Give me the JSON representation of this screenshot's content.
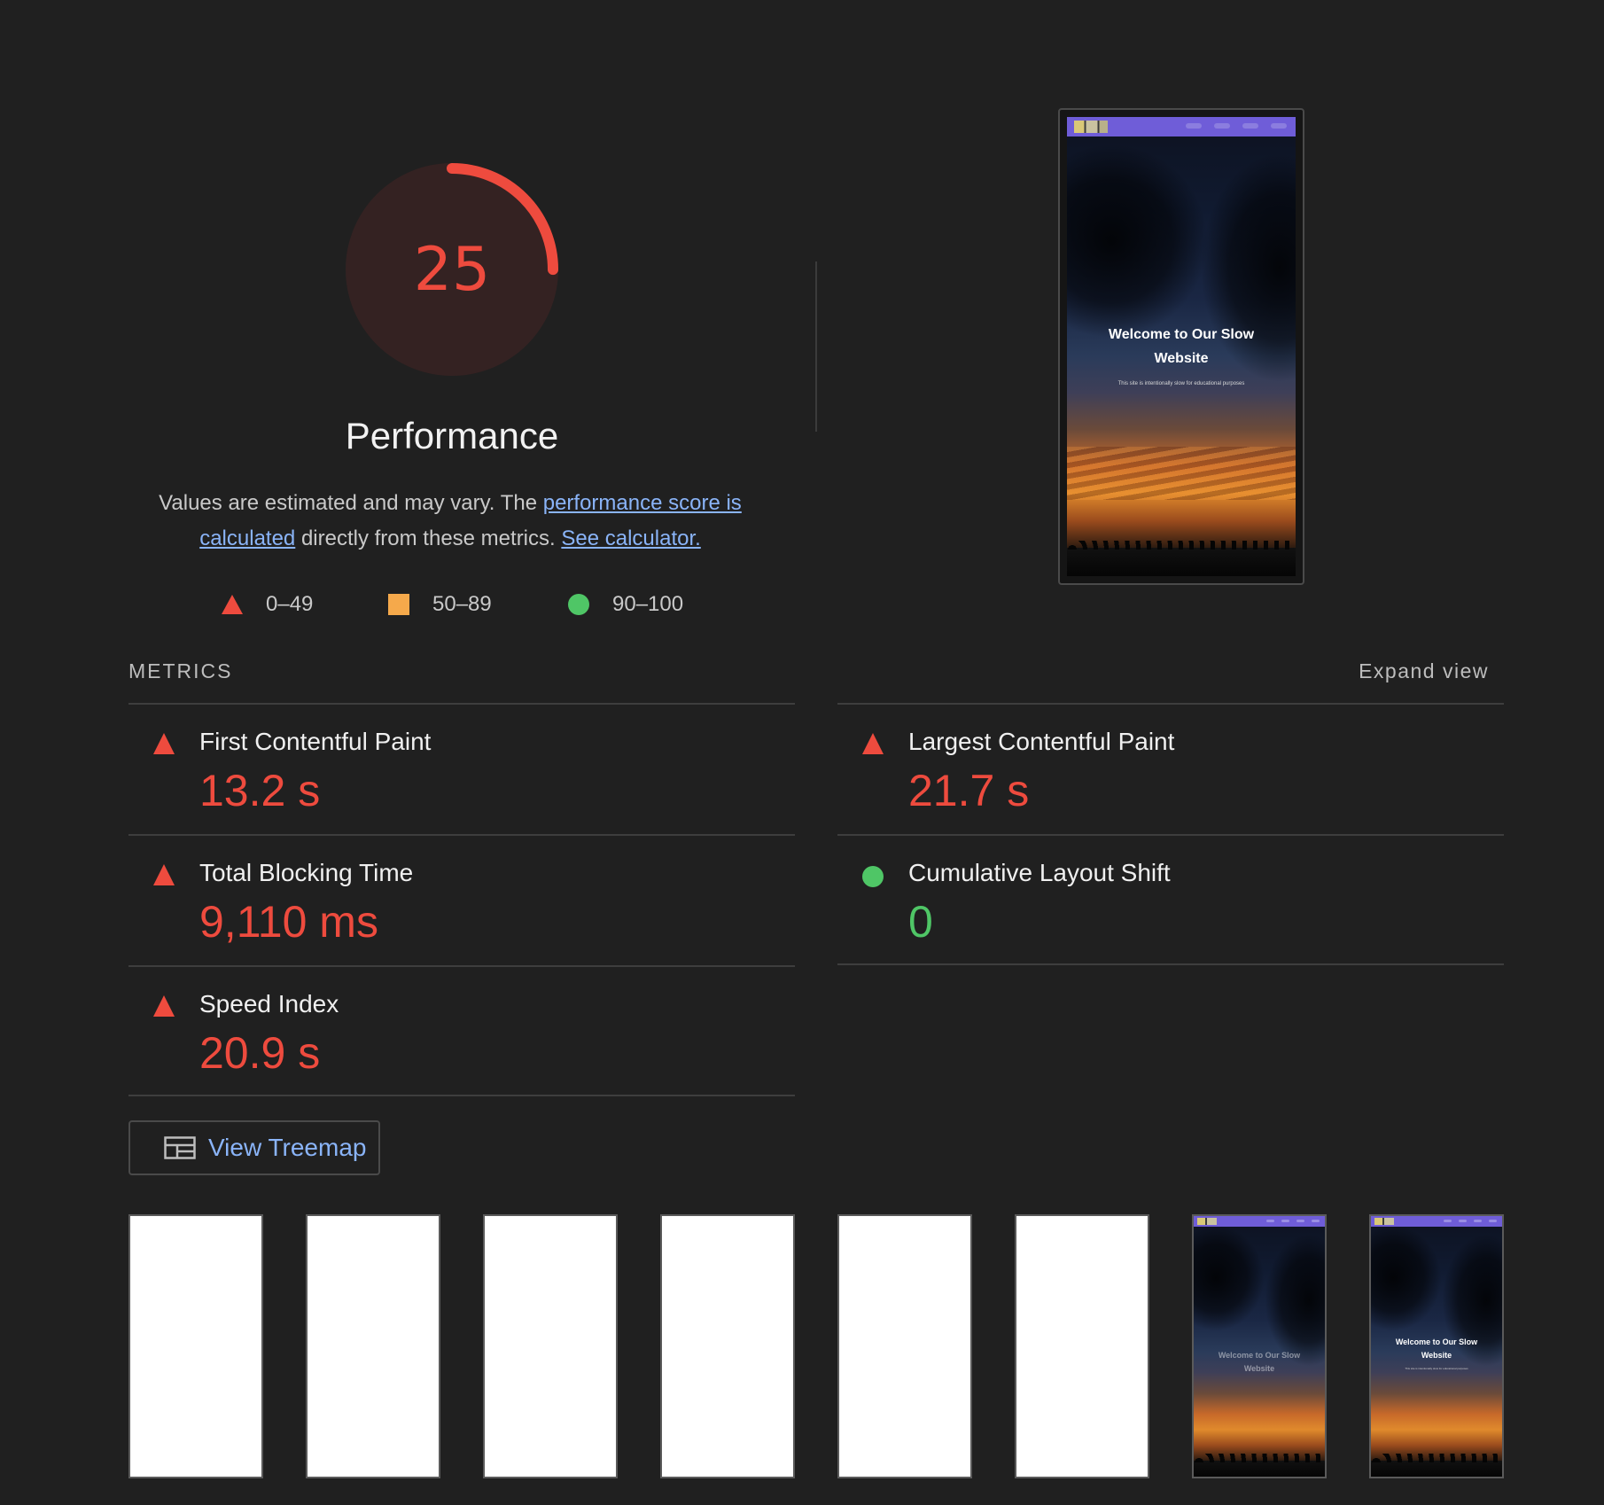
{
  "colors": {
    "background": "#202020",
    "fail": "#ee4b3e",
    "average": "#f5a94b",
    "pass": "#4fc666",
    "link": "#8ab4f8"
  },
  "gauge": {
    "score": "25",
    "score_fraction": 0.25,
    "title": "Performance"
  },
  "description": {
    "text_before": "Values are estimated and may vary. The ",
    "link1": "performance score is calculated",
    "text_middle": " directly from these metrics. ",
    "link2": "See calculator."
  },
  "legend": [
    {
      "shape": "triangle",
      "range": "0–49"
    },
    {
      "shape": "square",
      "range": "50–89"
    },
    {
      "shape": "circle",
      "range": "90–100"
    }
  ],
  "preview": {
    "nav_links": [
      "Home",
      "About",
      "Services",
      "Contact"
    ],
    "hero_title": "Welcome to Our Slow Website",
    "hero_subtitle": "This site is intentionally slow for educational purposes"
  },
  "metrics_section": {
    "header": "METRICS",
    "expand_label": "Expand view",
    "items": [
      {
        "name": "First Contentful Paint",
        "value": "13.2 s",
        "status": "fail"
      },
      {
        "name": "Largest Contentful Paint",
        "value": "21.7 s",
        "status": "fail"
      },
      {
        "name": "Total Blocking Time",
        "value": "9,110 ms",
        "status": "fail"
      },
      {
        "name": "Cumulative Layout Shift",
        "value": "0",
        "status": "pass"
      },
      {
        "name": "Speed Index",
        "value": "20.9 s",
        "status": "fail"
      }
    ]
  },
  "treemap_button": {
    "label": "View Treemap",
    "icon": "treemap-icon"
  },
  "filmstrip": {
    "frames": [
      {
        "type": "blank"
      },
      {
        "type": "blank"
      },
      {
        "type": "blank"
      },
      {
        "type": "blank"
      },
      {
        "type": "blank"
      },
      {
        "type": "blank"
      },
      {
        "type": "shot",
        "title": "Welcome to Our Slow Website",
        "title_opacity": 0.45
      },
      {
        "type": "shot",
        "title": "Welcome to Our Slow Website",
        "subtitle": "This site is intentionally slow for educational purposes",
        "title_opacity": 1
      }
    ]
  }
}
